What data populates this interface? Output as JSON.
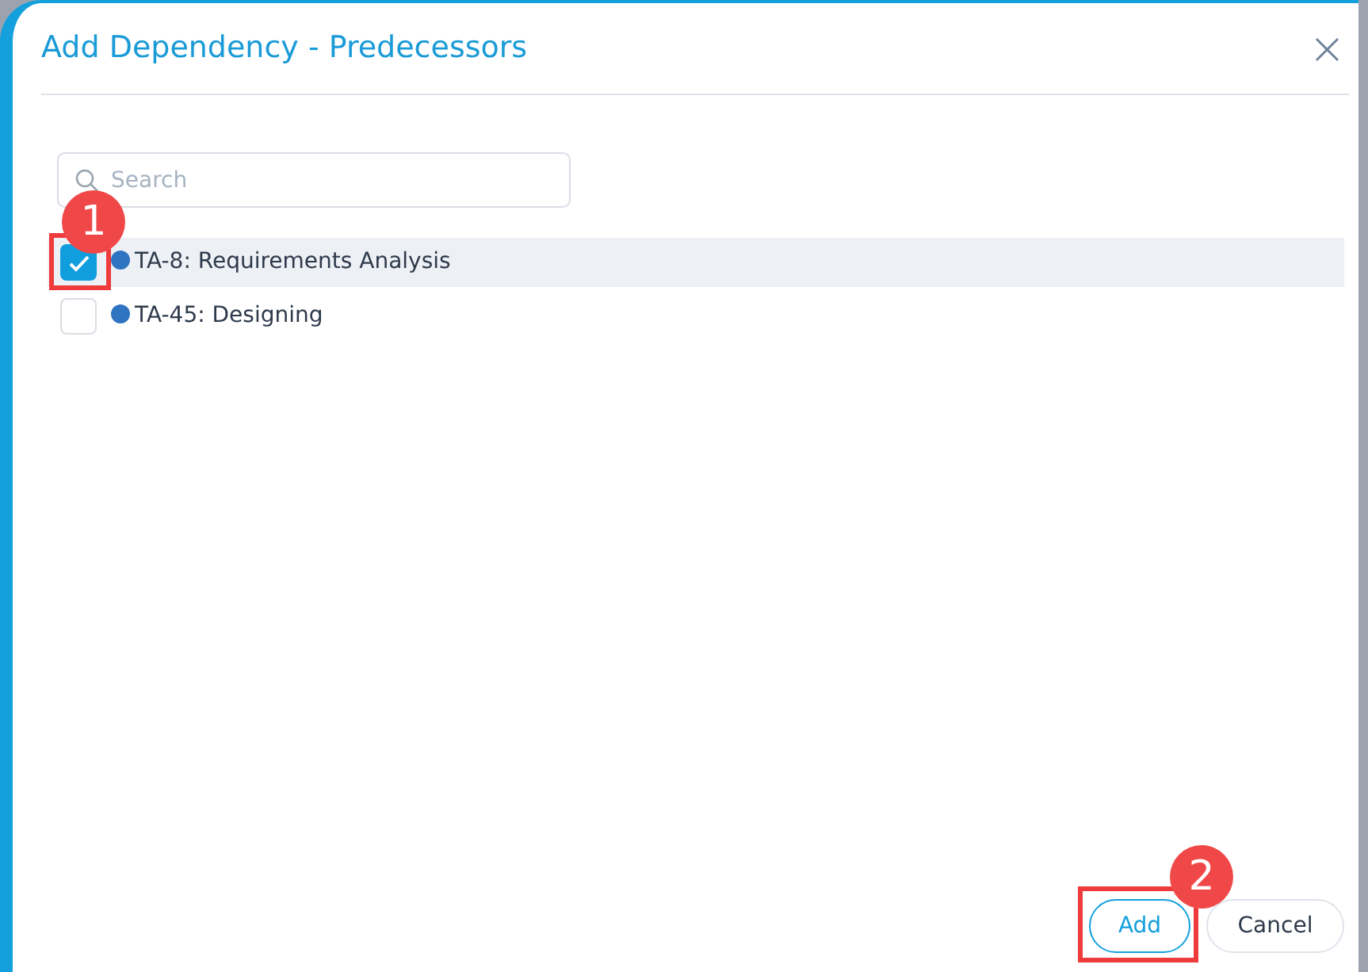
{
  "dialog": {
    "title": "Add Dependency - Predecessors",
    "close": "×"
  },
  "search": {
    "placeholder": "Search"
  },
  "items": [
    {
      "label": "TA-8: Requirements Analysis",
      "checked": true,
      "color": "#2f74c0"
    },
    {
      "label": "TA-45: Designing",
      "checked": false,
      "color": "#2f74c0"
    }
  ],
  "buttons": [
    {
      "label": "Add",
      "kind": "primary"
    },
    {
      "label": "Cancel",
      "kind": "secondary"
    }
  ],
  "annotations": [
    {
      "label": "1"
    },
    {
      "label": "2"
    }
  ]
}
